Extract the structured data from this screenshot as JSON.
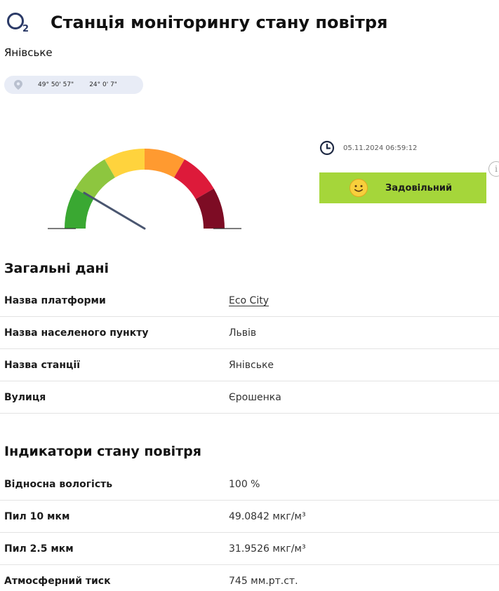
{
  "header": {
    "icon": "o2-icon",
    "icon_sub": "2",
    "title": "Станція моніторингу стану повітря"
  },
  "station": {
    "name": "Янівське",
    "latitude": "49° 50' 57\"",
    "longitude": "24° 0' 7\""
  },
  "gauge": {
    "icon": "aqi-gauge",
    "level_fraction": 0.17,
    "colors": [
      "#3aa832",
      "#8dc63f",
      "#ffd33d",
      "#ff9a30",
      "#dd1a3a",
      "#7d0c24"
    ]
  },
  "status": {
    "timestamp": "05.11.2024 06:59:12",
    "label": "Задовільний",
    "color": "#a5d63a",
    "info_symbol": "i"
  },
  "general": {
    "title": "Загальні дані",
    "rows": [
      {
        "label": "Назва платформи",
        "value": "Eco City"
      },
      {
        "label": "Назва населеного пункту",
        "value": "Львів"
      },
      {
        "label": "Назва станції",
        "value": "Янівське"
      },
      {
        "label": "Вулиця",
        "value": "Єрошенка"
      }
    ]
  },
  "air": {
    "title": "Індикатори стану повітря",
    "rows": [
      {
        "label": "Відносна вологість",
        "value": "100 %"
      },
      {
        "label": "Пил 10 мкм",
        "value": "49.0842 мкг/м³"
      },
      {
        "label": "Пил 2.5 мкм",
        "value": "31.9526 мкг/м³"
      },
      {
        "label": "Атмосферний тиск",
        "value": "745 мм.рт.ст."
      }
    ]
  }
}
